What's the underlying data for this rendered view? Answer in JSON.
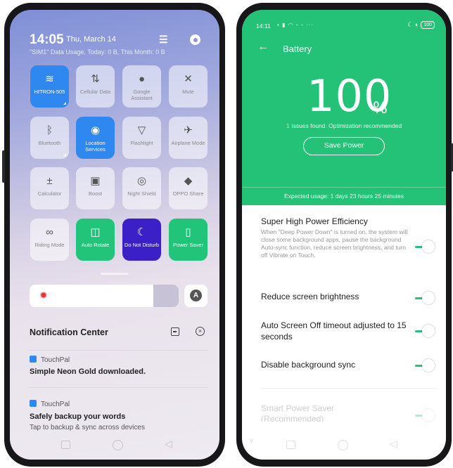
{
  "left_phone": {
    "time": "14:05",
    "date": "Thu, March 14",
    "data_usage": "\"SIM1\" Data Usage, Today: 0 B, This Month: 0 B",
    "edit_icon": "list-edit-icon",
    "settings_icon": "gear-icon",
    "tiles": [
      {
        "label": "HITRON-505",
        "icon": "≋",
        "icon_name": "wifi-icon",
        "state": "on"
      },
      {
        "label": "Cellular Data",
        "icon": "⇅",
        "icon_name": "cellular-data-icon",
        "state": "off"
      },
      {
        "label": "Google Assistant",
        "icon": "●",
        "icon_name": "microphone-icon",
        "state": "off"
      },
      {
        "label": "Mute",
        "icon": "✕",
        "icon_name": "mute-bell-icon",
        "state": "off"
      },
      {
        "label": "Bluetooth",
        "icon": "ᛒ",
        "icon_name": "bluetooth-icon",
        "state": "off"
      },
      {
        "label": "Location Services",
        "icon": "◉",
        "icon_name": "location-pin-icon",
        "state": "on"
      },
      {
        "label": "Flashlight",
        "icon": "▽",
        "icon_name": "flashlight-icon",
        "state": "off"
      },
      {
        "label": "Airplane Mode",
        "icon": "✈",
        "icon_name": "airplane-icon",
        "state": "off"
      },
      {
        "label": "Calculator",
        "icon": "±",
        "icon_name": "calculator-icon",
        "state": "off"
      },
      {
        "label": "Boost",
        "icon": "▣",
        "icon_name": "boost-trash-icon",
        "state": "off"
      },
      {
        "label": "Night Shield",
        "icon": "◎",
        "icon_name": "eye-icon",
        "state": "off"
      },
      {
        "label": "OPPO Share",
        "icon": "◆",
        "icon_name": "share-layers-icon",
        "state": "off"
      },
      {
        "label": "Riding Mode",
        "icon": "∞",
        "icon_name": "bicycle-icon",
        "state": "off"
      },
      {
        "label": "Auto Rotate",
        "icon": "◫",
        "icon_name": "rotate-icon",
        "state": "green"
      },
      {
        "label": "Do Not Disturb",
        "icon": "☾",
        "icon_name": "moon-icon",
        "state": "purple"
      },
      {
        "label": "Power Saver",
        "icon": "▯",
        "icon_name": "battery-saver-icon",
        "state": "green"
      }
    ],
    "brightness_level": 0.83,
    "auto_brightness_label": "A",
    "notification_center": {
      "title": "Notification Center",
      "notifications": [
        {
          "app": "TouchPal",
          "title": "Simple Neon Gold downloaded.",
          "text": ""
        },
        {
          "app": "TouchPal",
          "title": "Safely backup your words",
          "text": "Tap to backup & sync across devices"
        }
      ]
    }
  },
  "right_phone": {
    "status_time": "14:11",
    "battery_badge": "100",
    "page_title": "Battery",
    "battery_level": "100",
    "percent_sign": "%",
    "issues_count": "1",
    "issues_text": "issues found. Optimization recommended",
    "save_power_label": "Save Power",
    "expected_usage": "Expected usage: 1 days 23 hours 25 minutes",
    "settings": [
      {
        "title": "Super High Power Efficiency",
        "desc": "When \"Deep Power Down\" is turned on, the system will close some background apps, pause the background Auto-sync function, reduce screen brightness, and turn off Vibrate on Touch.",
        "enabled": true
      },
      {
        "title": "Reduce screen brightness",
        "desc": "",
        "enabled": true
      },
      {
        "title": "Auto Screen Off timeout adjusted to 15 seconds",
        "desc": "",
        "enabled": true
      },
      {
        "title": "Disable background sync",
        "desc": "",
        "enabled": true
      },
      {
        "title": "Smart Power Saver (Recommended)",
        "desc": "",
        "enabled": true
      }
    ]
  }
}
